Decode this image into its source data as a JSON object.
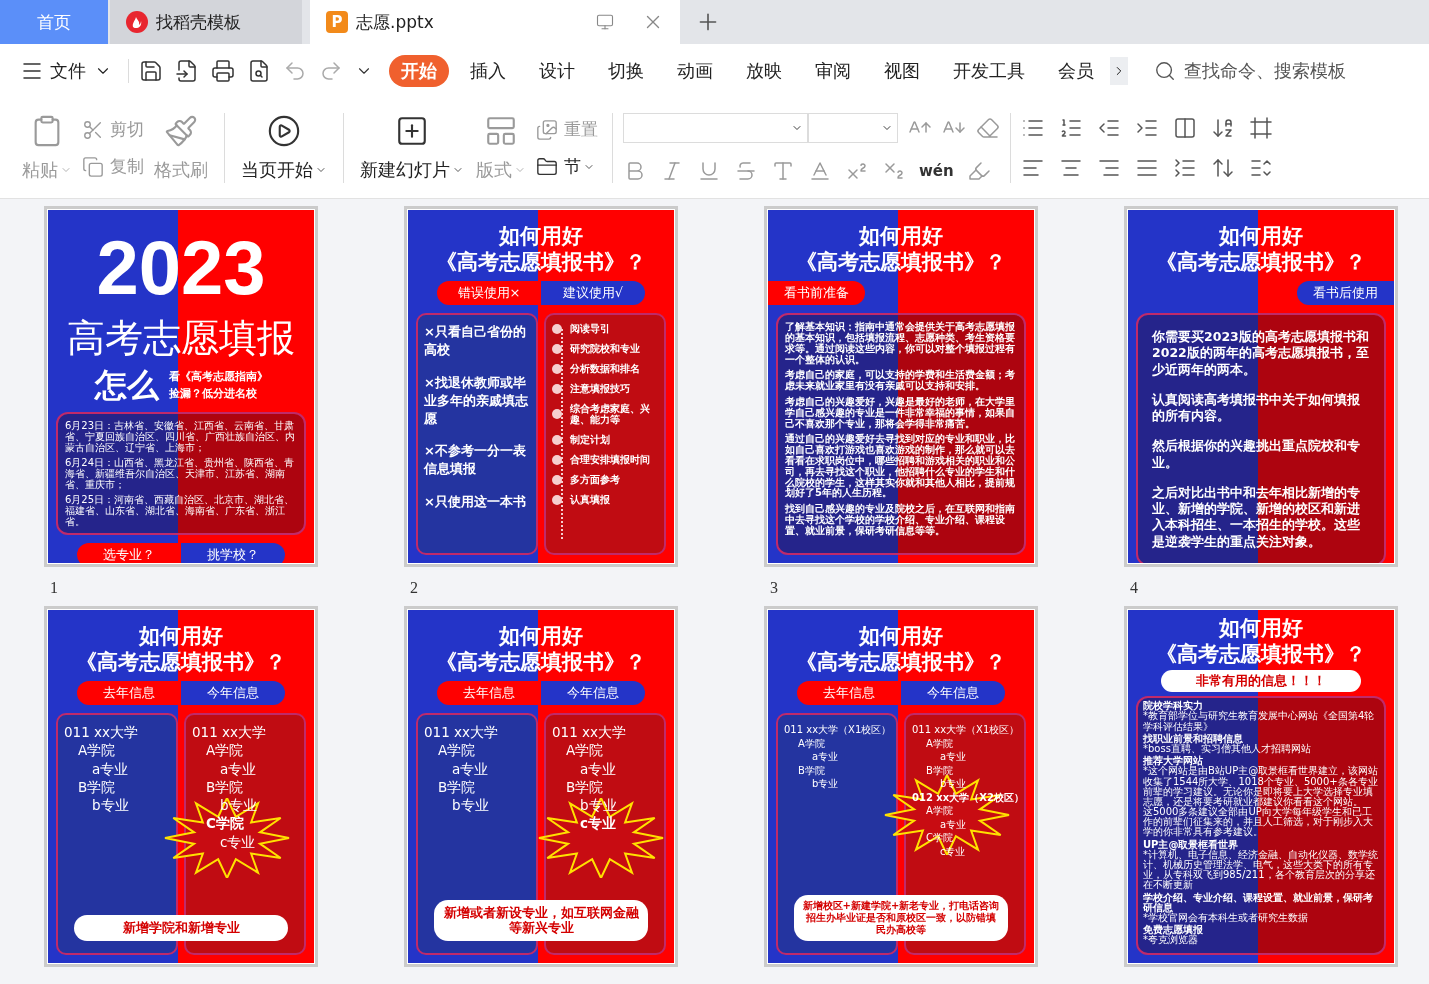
{
  "tabs": [
    {
      "label": "首页",
      "kind": "home",
      "selected": false
    },
    {
      "label": "找稻壳模板",
      "kind": "docer",
      "selected": false
    },
    {
      "label": "志愿.pptx",
      "kind": "file",
      "logo": "P",
      "selected": true
    }
  ],
  "menu": {
    "file": "文件",
    "items": [
      {
        "label": "开始",
        "selected": true
      },
      {
        "label": "插入",
        "selected": false
      },
      {
        "label": "设计",
        "selected": false
      },
      {
        "label": "切换",
        "selected": false
      },
      {
        "label": "动画",
        "selected": false
      },
      {
        "label": "放映",
        "selected": false
      },
      {
        "label": "审阅",
        "selected": false
      },
      {
        "label": "视图",
        "selected": false
      },
      {
        "label": "开发工具",
        "selected": false
      },
      {
        "label": "会员",
        "selected": false
      }
    ],
    "search": {
      "placeholder": "查找命令、搜索模板"
    }
  },
  "ribbon": {
    "paste": {
      "label": "粘贴",
      "disabled": true
    },
    "cut": {
      "label": "剪切",
      "disabled": true
    },
    "copy": {
      "label": "复制",
      "disabled": true
    },
    "painter": {
      "label": "格式刷",
      "disabled": true
    },
    "play": {
      "label": "当页开始",
      "disabled": false
    },
    "new_slide": {
      "label": "新建幻灯片",
      "disabled": false
    },
    "layout": {
      "label": "版式",
      "disabled": true
    },
    "reset": {
      "label": "重置",
      "disabled": true
    },
    "section": {
      "label": "节",
      "disabled": false
    },
    "font_tools_disabled": true,
    "pinyin": "wén"
  },
  "slides": [
    {
      "kind": "cover",
      "number": "1",
      "year": "2023",
      "title": "高考志愿填报",
      "how": "怎么",
      "sub": [
        "看《高考志愿指南》",
        "捡漏？低分进名校"
      ],
      "dates": [
        "6月23日：吉林省、安徽省、江西省、云南省、甘肃省、宁夏回族自治区、四川省、广西壮族自治区、内蒙古自治区、辽宁省、上海市；",
        "6月24日：山西省、黑龙江省、贵州省、陕西省、青海省、新疆维吾尔自治区、天津市、江苏省、湖南省、重庆市；",
        "6月25日：河南省、西藏自治区、北京市、湖北省、福建省、山东省、湖北省、海南省、广东省、浙江省。"
      ],
      "pills": [
        "选专业？",
        "挑学校？"
      ]
    },
    {
      "kind": "pros_cons",
      "number": "2",
      "title": [
        "如何用好",
        "《高考志愿填报书》？"
      ],
      "pills": [
        "错误使用×",
        "建议使用√"
      ],
      "wrong": [
        "×只看自己省份的高校",
        "×找退休教师或毕业多年的亲戚填志愿",
        "×不参考一分一表信息填报",
        "×只使用这一本书"
      ],
      "steps": [
        "阅读导引",
        "研究院校和专业",
        "分析数据和排名",
        "注意填报技巧",
        "综合考虑家庭、兴趣、能力等",
        "制定计划",
        "合理安排填报时间",
        "多方面参考",
        "认真填报"
      ]
    },
    {
      "kind": "text_panel",
      "number": "3",
      "title": [
        "如何用好",
        "《高考志愿填报书》？"
      ],
      "banner": {
        "label": "看书前准备",
        "kind": "left"
      },
      "paragraphs": [
        "了解基本知识：指南中通常会提供关于高考志愿填报的基本知识，包括填报流程、志愿种类、考生资格要求等。通过阅读这些内容，你可以对整个填报过程有一个整体的认识。",
        "考虑自己的家庭，可以支持的学费和生活费金额；考虑未来就业家里有没有亲戚可以支持和安排。",
        "考虑自己的兴趣爱好，兴趣是最好的老师，在大学里学自己感兴趣的专业是一件非常幸福的事情，如果自己不喜欢那个专业，那将会学得非常痛苦。",
        "通过自己的兴趣爱好去寻找到对应的专业和职业，比如自己喜欢打游戏也喜欢游戏的制作，那么就可以去看看在求职岗位中，哪些招聘和游戏相关的职业和公司，再去寻找这个职业，他招聘什么专业的学生和什么院校的学生，这样其实你就和其他人相比，提前规划好了5年的人生历程。",
        "找到自己感兴趣的专业及院校之后，在互联网和指南中去寻找这个学校的学校介绍、专业介绍、课程设置、就业前景，保研考研信息等等。"
      ]
    },
    {
      "kind": "text_panel",
      "number": "4",
      "title": [
        "如何用好",
        "《高考志愿填报书》？"
      ],
      "banner": {
        "label": "看书后使用",
        "kind": "right"
      },
      "paragraphs": [
        "你需要买2023版的高考志愿填报书和2022版的两年的高考志愿填报书，至少近两年的两本。",
        "认真阅读高考填报书中关于如何填报的所有内容。",
        "然后根据你的兴趣挑出重点院校和专业。",
        "之后对比出书中和去年相比新增的专业、新增的学院、新增的校区和新进入本科招生、一本招生的学校。这些是逆袭学生的重点关注对象。"
      ]
    },
    {
      "kind": "compare",
      "title": [
        "如何用好",
        "《高考志愿填报书》？"
      ],
      "pills": [
        "去年信息",
        "今年信息"
      ],
      "last_year": [
        {
          "label": "011 xx大学",
          "new": false,
          "children": [
            {
              "label": "A学院",
              "new": false,
              "children": [
                {
                  "label": "a专业",
                  "new": false
                }
              ]
            },
            {
              "label": "B学院",
              "new": false,
              "children": [
                {
                  "label": "b专业",
                  "new": false
                }
              ]
            }
          ]
        }
      ],
      "this_year": [
        {
          "label": "011 xx大学",
          "new": false,
          "children": [
            {
              "label": "A学院",
              "new": false,
              "children": [
                {
                  "label": "a专业",
                  "new": false
                }
              ]
            },
            {
              "label": "B学院",
              "new": false,
              "children": [
                {
                  "label": "b专业",
                  "new": false
                }
              ]
            },
            {
              "label": "C学院",
              "new": true,
              "children": [
                {
                  "label": "c专业",
                  "new": false
                }
              ]
            }
          ]
        }
      ],
      "note": "新增学院和新增专业"
    },
    {
      "kind": "compare",
      "title": [
        "如何用好",
        "《高考志愿填报书》？"
      ],
      "pills": [
        "去年信息",
        "今年信息"
      ],
      "last_year": [
        {
          "label": "011 xx大学",
          "new": false,
          "children": [
            {
              "label": "A学院",
              "new": false,
              "children": [
                {
                  "label": "a专业",
                  "new": false
                }
              ]
            },
            {
              "label": "B学院",
              "new": false,
              "children": [
                {
                  "label": "b专业",
                  "new": false
                }
              ]
            }
          ]
        }
      ],
      "this_year": [
        {
          "label": "011 xx大学",
          "new": false,
          "children": [
            {
              "label": "A学院",
              "new": false,
              "children": [
                {
                  "label": "a专业",
                  "new": false
                }
              ]
            },
            {
              "label": "B学院",
              "new": false,
              "children": [
                {
                  "label": "b专业",
                  "new": false
                },
                {
                  "label": "c专业",
                  "new": true
                }
              ]
            }
          ]
        }
      ],
      "note": "新增或者新设专业，如互联网金融等新兴专业"
    },
    {
      "kind": "compare",
      "title": [
        "如何用好",
        "《高考志愿填报书》？"
      ],
      "pills": [
        "去年信息",
        "今年信息"
      ],
      "last_year": [
        {
          "label": "011 xx大学（X1校区）",
          "new": false,
          "children": [
            {
              "label": "A学院",
              "new": false,
              "children": [
                {
                  "label": "a专业",
                  "new": false
                }
              ]
            },
            {
              "label": "B学院",
              "new": false,
              "children": [
                {
                  "label": "b专业",
                  "new": false
                }
              ]
            }
          ]
        }
      ],
      "this_year": [
        {
          "label": "011 xx大学（X1校区）",
          "new": false,
          "children": [
            {
              "label": "A学院",
              "new": false,
              "children": [
                {
                  "label": "a专业",
                  "new": false
                }
              ]
            },
            {
              "label": "B学院",
              "new": false,
              "children": [
                {
                  "label": "b专业",
                  "new": false
                }
              ]
            }
          ]
        },
        {
          "label": "012 xx大学（X2校区）",
          "new": true,
          "children": [
            {
              "label": "A学院",
              "new": false,
              "children": [
                {
                  "label": "a专业",
                  "new": false
                }
              ]
            },
            {
              "label": "C学院",
              "new": false,
              "children": [
                {
                  "label": "c专业",
                  "new": false
                }
              ]
            }
          ]
        }
      ],
      "note": "新增校区+新建学院+新老专业，打电话咨询招生办毕业证是否和原校区一致，以防错填民办高校等"
    },
    {
      "kind": "info_list",
      "title": [
        "如何用好",
        "《高考志愿填报书》？"
      ],
      "banner": "非常有用的信息！！！",
      "sections": [
        {
          "heading": "院校学科实力",
          "body": [
            "*教育部学位与研究生教育发展中心网站《全国第4轮学科评估结果》"
          ]
        },
        {
          "heading": "找职业前景和招聘信息",
          "body": [
            "*boss直聘、实习僧其他人才招聘网站"
          ]
        },
        {
          "heading": "推荐大学网站",
          "body": [
            "*这个网站是由B站UP主@取景框看世界建立，该网站收集了1544所大学、1018个专业、5000+条各专业前辈的学习建议。无论你是即将要上大学选择专业填志愿，还是将要考研就业都建议你看看这个网站。",
            "这5000多条建议全部由UP向大学每年级学生和已工作的前辈们征集来的，并且人工筛选，对于刚步入大学的你非常具有参考建议。"
          ]
        },
        {
          "heading": "UP主@取景框看世界",
          "body": [
            "*计算机、电子信息、经济金融、自动化仪器、数学统计、机械历史管理法学、电气，这些大类下的所有专业，从专科双飞到985/211，各个教育层次的分享还在不断更新"
          ]
        },
        {
          "heading": "学校介绍、专业介绍、课程设置、就业前景，保研考研信息",
          "body": [
            "*学校官网会有本科生或者研究生数据"
          ]
        },
        {
          "heading": "免费志愿填报",
          "body": [
            "*夸克浏览器"
          ]
        }
      ]
    }
  ]
}
